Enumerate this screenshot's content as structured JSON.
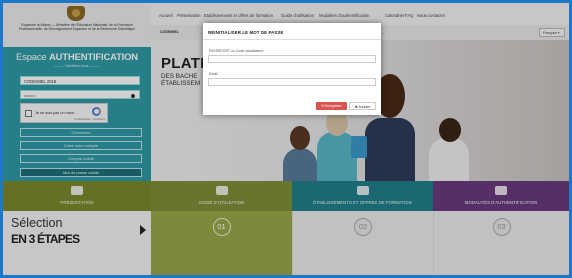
{
  "ministry_text": "Royaume du Maroc — Ministère de l'Éducation Nationale, de la Formation Professionnelle, de l'Enseignement Supérieur et de la Recherche Scientifique",
  "sidebar": {
    "espace_prefix": "Espace",
    "espace_title": "AUTHENTIFICATION",
    "espace_subtitle": "——— Identifiez-vous ———",
    "cin_value": "CODEMIEL 2018",
    "password_placeholder": "••••••••",
    "captcha_label": "Je ne suis pas un robot",
    "captcha_terms": "Confidentialité - Conditions",
    "btn_login": "Connexion",
    "btn_forgot": "Créer votre compte",
    "btn_account": "Compte oublié",
    "btn_guide": "Mot de passe oublié"
  },
  "topnav": {
    "items": [
      "Accueil",
      "Présentation",
      "Etablissements et offres de formation",
      "Guide d'utilisation",
      "Modalités d'authentification",
      "Calendrier",
      "FAQ",
      "Nous contacter"
    ]
  },
  "subbar": {
    "label": "CODEMIEL",
    "lang": "Français ▾"
  },
  "hero": {
    "title": "PLATE",
    "sub_line1": "DES BACHE",
    "sub_line2": "ÉTABLISSEM"
  },
  "features": [
    {
      "label": "PRÉSENTATION",
      "color": "#7a8a2e"
    },
    {
      "label": "GUIDE D'UTILISATION",
      "color": "#7f8f3a"
    },
    {
      "label": "ÉTABLISSEMENTS ET OFFRES DE FORMATION",
      "color": "#1f7f8c"
    },
    {
      "label": "MODALITÉS D'AUTHENTIFICATION",
      "color": "#6a3a7e"
    }
  ],
  "steps": {
    "title": "Sélection",
    "subtitle": "EN 3 ÉTAPES",
    "numbers": [
      "01",
      "02",
      "03"
    ]
  },
  "modal": {
    "title": "RÉINITIALISER LE MOT DE PASSE",
    "label_cin": "PASSEPORT ou Code candidature",
    "label_email": "Email",
    "btn_submit": "✉ Enregistrer",
    "btn_cancel": "✖ Annuler"
  },
  "colors": {
    "sidebar": "#2e9aa6",
    "frame_border": "#1e78c8",
    "submit": "#d9534f"
  }
}
